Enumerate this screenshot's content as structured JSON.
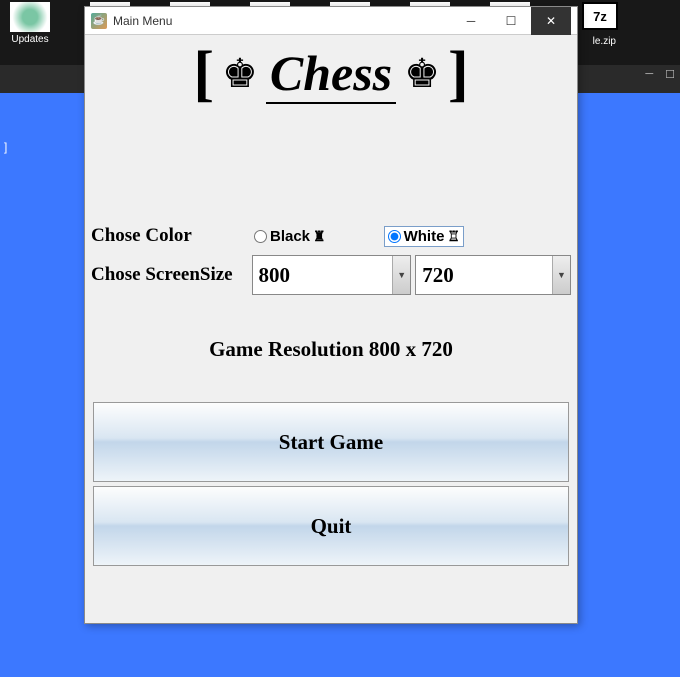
{
  "desktop": {
    "icons": [
      {
        "label": "Updates",
        "kind": "gear"
      },
      {
        "label": "",
        "kind": "gear"
      },
      {
        "label": "",
        "kind": "gear"
      },
      {
        "label": "",
        "kind": "gear"
      },
      {
        "label": "",
        "kind": "gear"
      },
      {
        "label": "",
        "kind": "gear"
      }
    ],
    "right_file_label": "le.zip",
    "right_file_icon_text": "7z"
  },
  "sidebar_bracket": "]",
  "window": {
    "title": "Main Menu",
    "header": {
      "left_bracket": "[",
      "right_bracket": "]",
      "title": "Chess",
      "king_left": "♚",
      "king_right": "♚"
    },
    "form": {
      "color_label": "Chose Color",
      "color_black": "Black",
      "color_white": "White",
      "color_selected": "White",
      "black_piece": "♜",
      "white_piece": "♖",
      "size_label": "Chose ScreenSize",
      "width_value": "800",
      "height_value": "720",
      "resolution_text": "Game Resolution 800 x 720"
    },
    "buttons": {
      "start": "Start Game",
      "quit": "Quit"
    }
  }
}
